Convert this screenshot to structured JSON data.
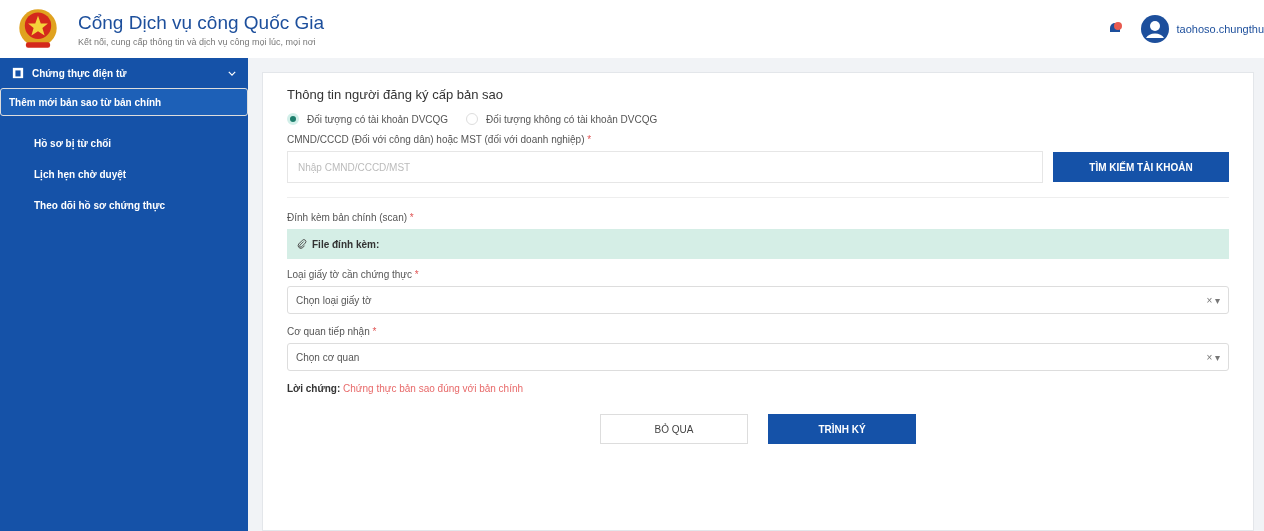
{
  "header": {
    "title": "Cổng Dịch vụ công Quốc Gia",
    "subtitle": "Kết nối, cung cấp thông tin và dịch vụ công mọi lúc, mọi nơi",
    "username": "taohoso.chungthu",
    "notification": true
  },
  "sidebar": {
    "group": {
      "label": "Chứng thực điện tử",
      "expanded": true
    },
    "items": [
      {
        "label": "Thêm mới bản sao từ bản chính",
        "selected": true
      },
      {
        "label": "Hồ sơ bị từ chối",
        "selected": false
      },
      {
        "label": "Lịch hẹn chờ duyệt",
        "selected": false
      },
      {
        "label": "Theo dõi hồ sơ chứng thực",
        "selected": false
      }
    ]
  },
  "form": {
    "section_title": "Thông tin người đăng ký cấp bản sao",
    "radios": [
      {
        "label": "Đối tượng có tài khoản DVCQG",
        "selected": true
      },
      {
        "label": "Đối tượng không có tài khoản DVCQG",
        "selected": false
      }
    ],
    "id_field": {
      "label": "CMND/CCCD (Đối với công dân) hoặc MST (đối với doanh nghiệp)",
      "required_mark": "*",
      "placeholder": "Nhập CMND/CCCD/MST"
    },
    "search_button": "TÌM KIẾM TÀI KHOẢN",
    "attachment": {
      "label": "Đính kèm bản chính (scan)",
      "required_mark": "*",
      "box_text": "File đính kèm:"
    },
    "selects": [
      {
        "label": "Loại giấy tờ cần chứng thực",
        "required_mark": "*",
        "placeholder": "Chọn loại giấy tờ",
        "clear": "×",
        "caret": "▾"
      },
      {
        "label": "Cơ quan tiếp nhận",
        "required_mark": "*",
        "placeholder": "Chọn cơ quan",
        "clear": "×",
        "caret": "▾"
      }
    ],
    "attestation": {
      "label": "Lời chứng:",
      "value": "Chứng thực bản sao đúng với bản chính"
    },
    "buttons": [
      {
        "label": "BỎ QUA",
        "kind": "secondary"
      },
      {
        "label": "TRÌNH KÝ",
        "kind": "primary"
      }
    ]
  }
}
